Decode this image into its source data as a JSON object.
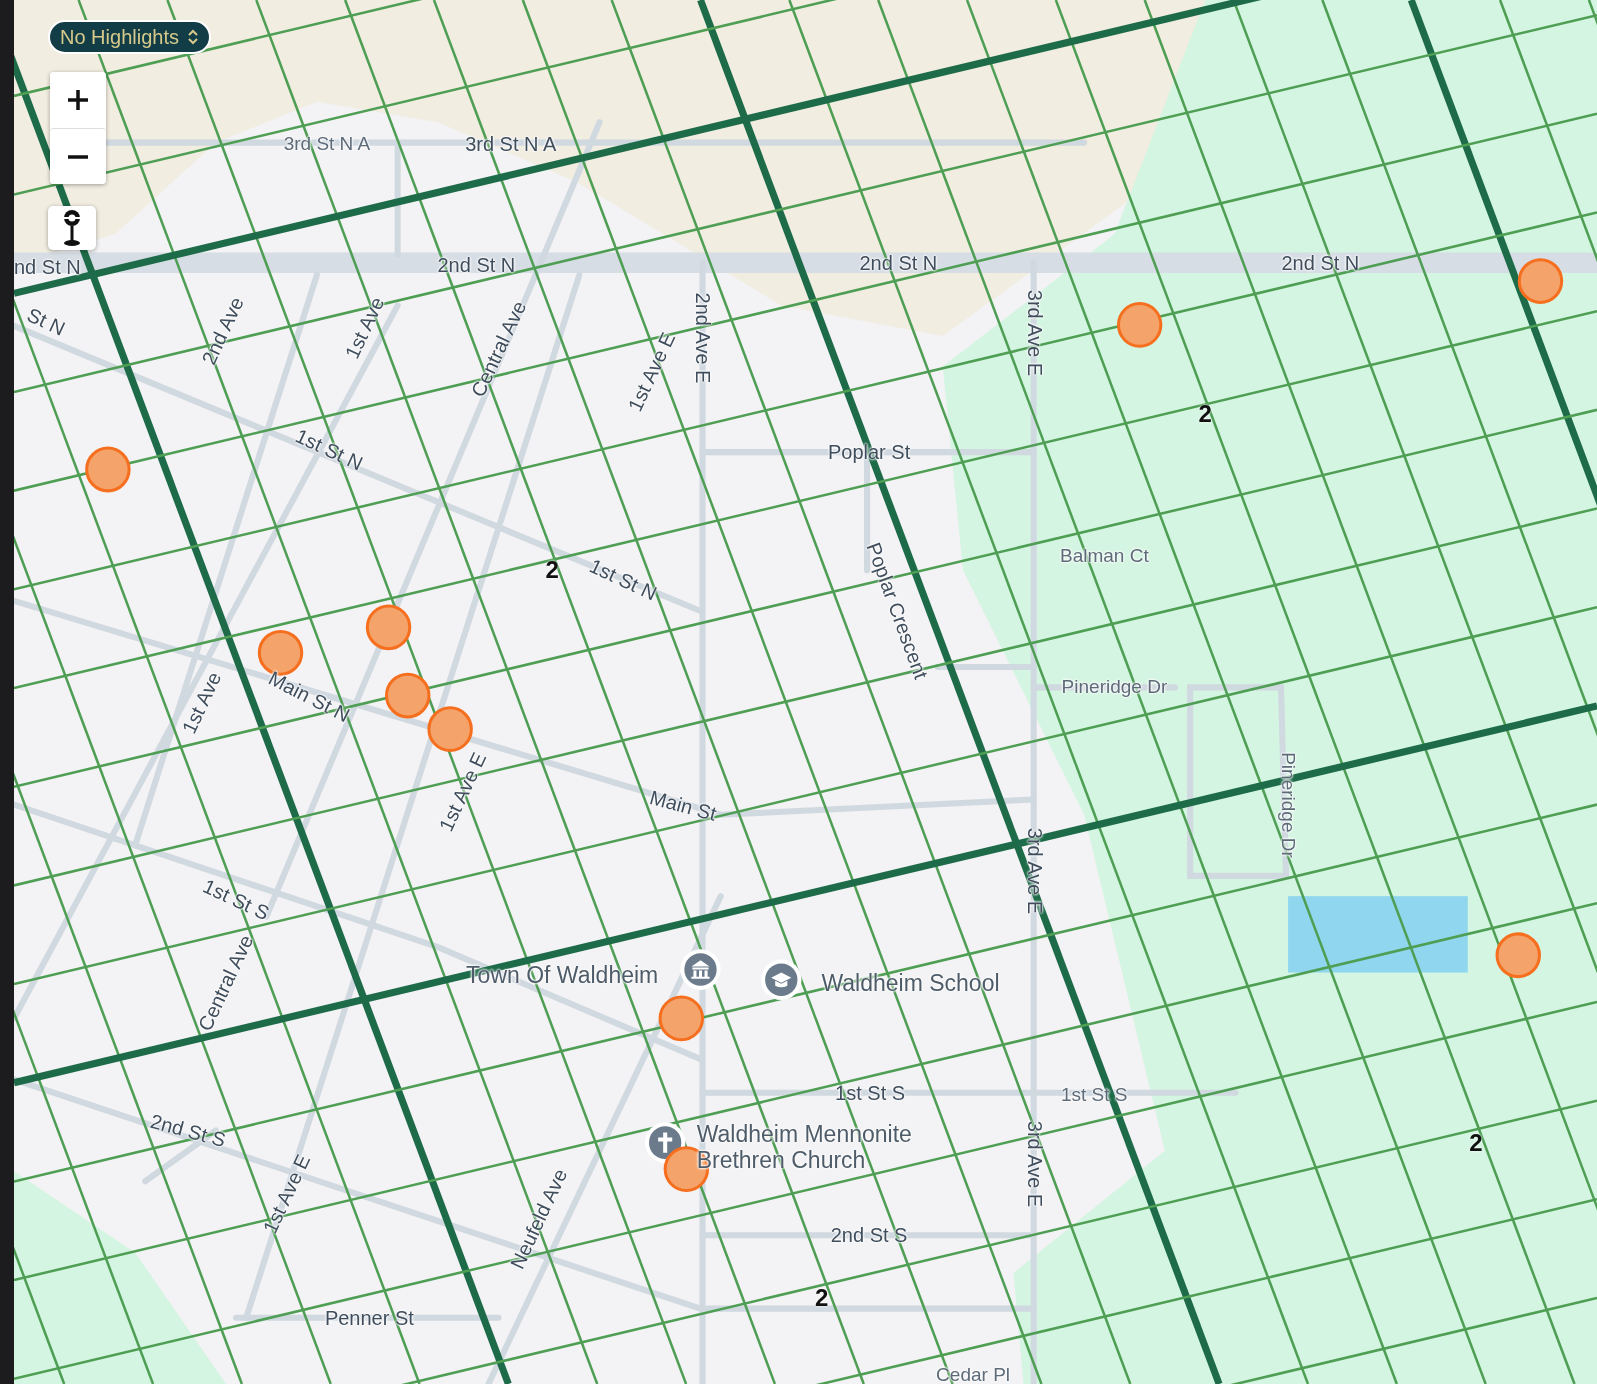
{
  "highlight_select": {
    "value": "No Highlights"
  },
  "map": {
    "labels": [
      {
        "text": "3rd St N A",
        "kind": "minor"
      },
      {
        "text": "3rd St N A",
        "kind": "street"
      },
      {
        "text": "nd St N",
        "kind": "street"
      },
      {
        "text": "2nd St N",
        "kind": "street"
      },
      {
        "text": "2nd St N",
        "kind": "street"
      },
      {
        "text": "2nd St N",
        "kind": "street"
      },
      {
        "text": "St N",
        "kind": "street"
      },
      {
        "text": "2nd Ave",
        "kind": "street"
      },
      {
        "text": "1st Ave",
        "kind": "street"
      },
      {
        "text": "Central Ave",
        "kind": "street"
      },
      {
        "text": "1st Ave E",
        "kind": "street"
      },
      {
        "text": "2nd Ave E",
        "kind": "street"
      },
      {
        "text": "3rd Ave E",
        "kind": "street"
      },
      {
        "text": "1st St N",
        "kind": "street"
      },
      {
        "text": "Poplar St",
        "kind": "street"
      },
      {
        "text": "1st St N",
        "kind": "street"
      },
      {
        "text": "Balman Ct",
        "kind": "minor"
      },
      {
        "text": "Poplar Crescent",
        "kind": "street"
      },
      {
        "text": "Pineridge Dr",
        "kind": "minor"
      },
      {
        "text": "Main St N",
        "kind": "street"
      },
      {
        "text": "1st Ave",
        "kind": "street"
      },
      {
        "text": "1st Ave E",
        "kind": "street"
      },
      {
        "text": "Main St",
        "kind": "street"
      },
      {
        "text": "Pineridge Dr",
        "kind": "minor"
      },
      {
        "text": "3rd Ave E",
        "kind": "street"
      },
      {
        "text": "1st St S",
        "kind": "street"
      },
      {
        "text": "Central Ave",
        "kind": "street"
      },
      {
        "text": "Town Of Waldheim",
        "kind": "place"
      },
      {
        "text": "Waldheim School",
        "kind": "place"
      },
      {
        "text": "1st St S",
        "kind": "street"
      },
      {
        "text": "1st St S",
        "kind": "minor"
      },
      {
        "text": "2nd St S",
        "kind": "street"
      },
      {
        "text": "Waldheim Mennonite Brethren Church",
        "kind": "place"
      },
      {
        "text": "3rd Ave E",
        "kind": "street"
      },
      {
        "text": "1st Ave E",
        "kind": "street"
      },
      {
        "text": "Neufeld Ave",
        "kind": "street"
      },
      {
        "text": "2nd St S",
        "kind": "street"
      },
      {
        "text": "Penner St",
        "kind": "street"
      },
      {
        "text": "Cedar Pl",
        "kind": "minor"
      }
    ],
    "grid_labels": [
      "2",
      "2",
      "2",
      "2"
    ]
  }
}
